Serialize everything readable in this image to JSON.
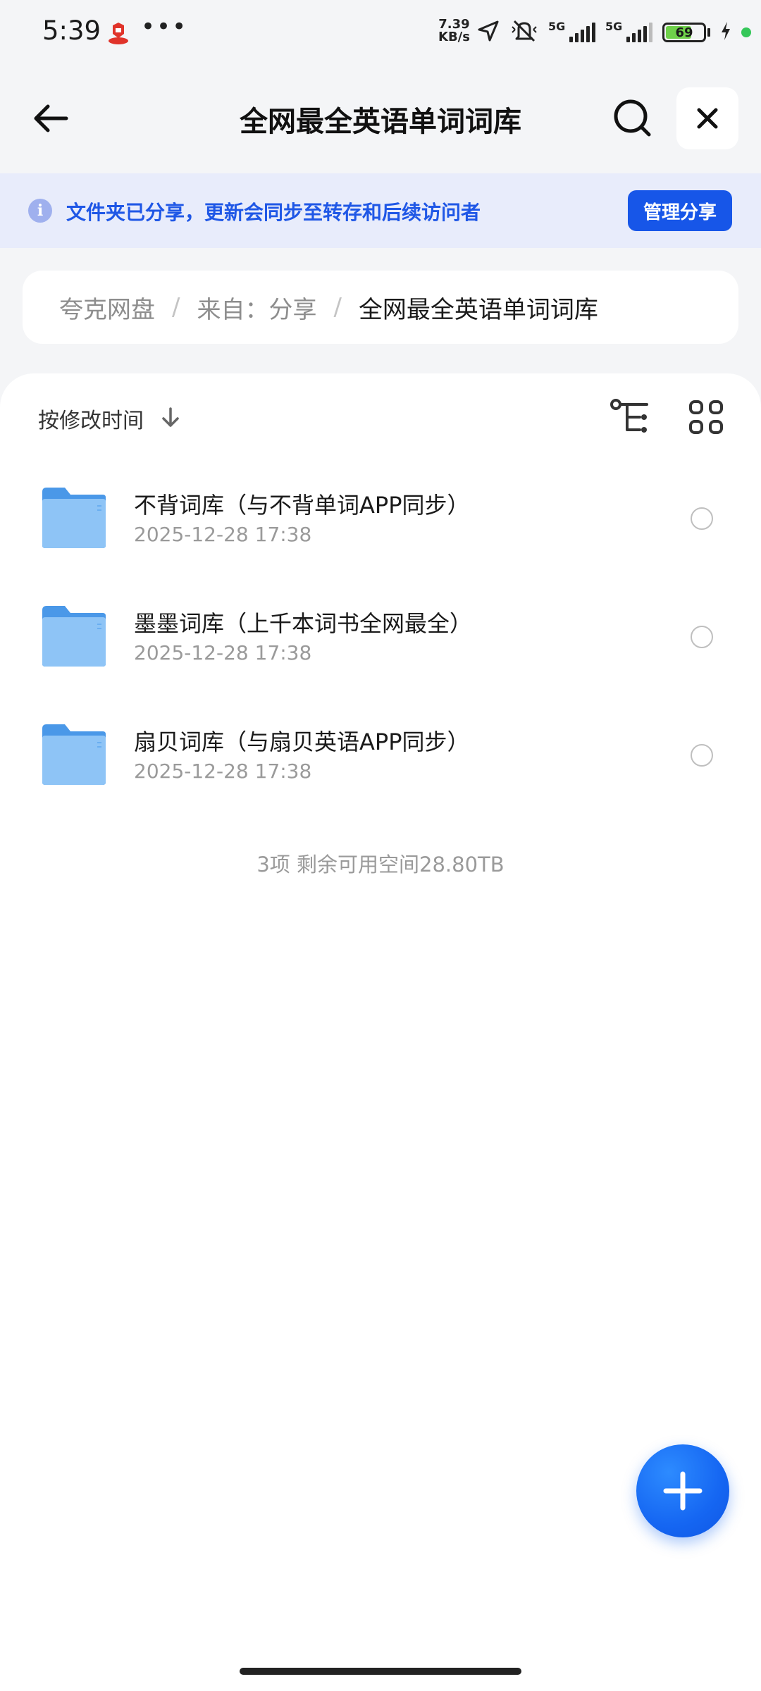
{
  "status_bar": {
    "time": "5:39",
    "more": "•••",
    "net_speed_value": "7.39",
    "net_speed_unit": "KB/s",
    "sim1_label": "5G",
    "sim2_label": "5G",
    "battery_level": "69"
  },
  "header": {
    "title": "全网最全英语单词词库"
  },
  "banner": {
    "text": "文件夹已分享，更新会同步至转存和后续访问者",
    "manage_button": "管理分享"
  },
  "breadcrumb": {
    "items": [
      "夸克网盘",
      "来自：分享",
      "全网最全英语单词词库"
    ],
    "separator": "/"
  },
  "toolbar": {
    "sort_label": "按修改时间"
  },
  "files": [
    {
      "name": "不背词库（与不背单词APP同步）",
      "date": "2025-12-28 17:38"
    },
    {
      "name": "墨墨词库（上千本词书全网最全）",
      "date": "2025-12-28 17:38"
    },
    {
      "name": "扇贝词库（与扇贝英语APP同步）",
      "date": "2025-12-28 17:38"
    }
  ],
  "summary": "3项  剩余可用空间28.80TB",
  "colors": {
    "accent": "#1756e8",
    "banner_bg": "#e8ecfb",
    "folder": "#5aa8f0",
    "battery_fill": "#6fd14a"
  }
}
